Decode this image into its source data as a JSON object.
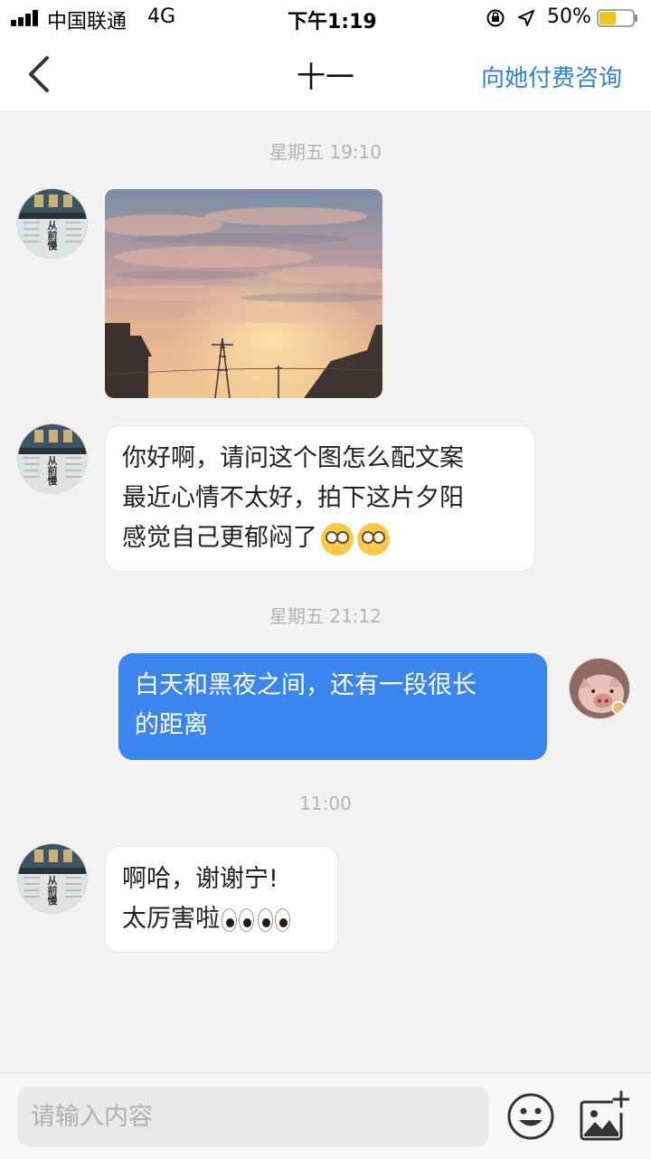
{
  "status_bar": {
    "carrier": "中国联通",
    "network": "4G",
    "time": "下午1:19",
    "battery": "50%",
    "battery_level": 0.5
  },
  "header": {
    "title": "十一",
    "action_label": "向她付费咨询"
  },
  "messages": {
    "timestamp_1": "星期五 19:10",
    "msg_2": {
      "line_1": "你好啊，请问这个图怎么配文案",
      "line_2": "最近心情不太好，拍下这片夕阳",
      "line_3": "感觉自己更郁闷了"
    },
    "timestamp_2": "星期五 21:12",
    "msg_3": {
      "line_1": "白天和黑夜之间，还有一段很长",
      "line_2": "的距离"
    },
    "timestamp_3": "11:00",
    "msg_4": {
      "line_1": "啊哈，谢谢宁!",
      "line_2": "太厉害啦"
    }
  },
  "avatar_left": {
    "glyphs": [
      "从",
      "前",
      "慢"
    ]
  },
  "input": {
    "placeholder": "请输入内容"
  },
  "colors": {
    "accent": "#2f7fe0",
    "outgoing_bubble": "#3b85ef",
    "background": "#f2f2f2"
  },
  "icons": [
    "back-chevron-icon",
    "emoji-icon",
    "add-image-icon",
    "location-arrow-icon",
    "orientation-lock-icon",
    "battery-icon",
    "signal-icon"
  ]
}
